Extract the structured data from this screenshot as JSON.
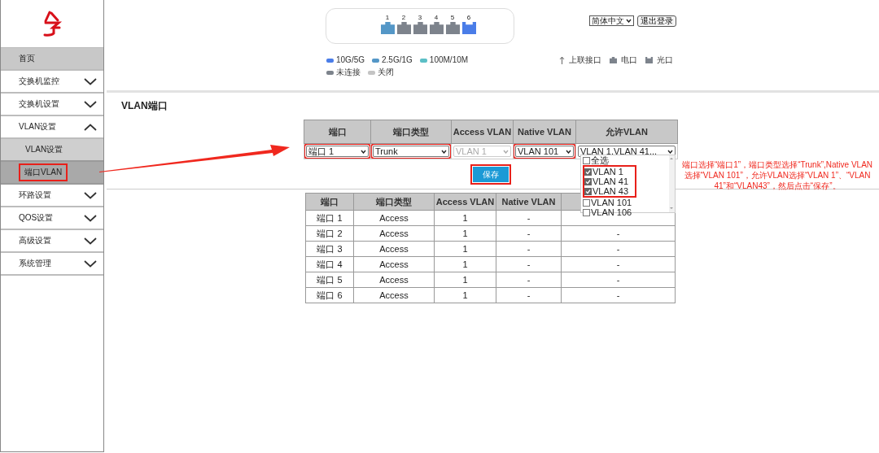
{
  "sidebar": {
    "items": [
      {
        "kind": "home",
        "label": "首页",
        "selected": true
      },
      {
        "kind": "group",
        "label": "交换机监控",
        "expanded": false,
        "selected": false
      },
      {
        "kind": "group",
        "label": "交换机设置",
        "expanded": false,
        "selected": false
      },
      {
        "kind": "group",
        "label": "VLAN设置",
        "expanded": true,
        "selected": false,
        "children": [
          {
            "label": "VLAN设置",
            "selected": false,
            "highlighted": false
          },
          {
            "label": "端口VLAN",
            "selected": true,
            "highlighted": true
          }
        ]
      },
      {
        "kind": "group",
        "label": "环路设置",
        "expanded": false,
        "selected": false
      },
      {
        "kind": "group",
        "label": "QOS设置",
        "expanded": false,
        "selected": false
      },
      {
        "kind": "group",
        "label": "高级设置",
        "expanded": false,
        "selected": false
      },
      {
        "kind": "group",
        "label": "系统管理",
        "expanded": false,
        "selected": false
      }
    ]
  },
  "port_panel": {
    "ports": [
      {
        "label": "1",
        "kind": "electric",
        "color": "#5497c7"
      },
      {
        "label": "2",
        "kind": "electric",
        "color": "#7d838c"
      },
      {
        "label": "3",
        "kind": "electric",
        "color": "#7d838c"
      },
      {
        "label": "4",
        "kind": "electric",
        "color": "#7d838c"
      },
      {
        "label": "5",
        "kind": "electric",
        "color": "#7d838c"
      },
      {
        "label": "6",
        "kind": "optical",
        "color": "#4a7de8"
      }
    ]
  },
  "header": {
    "language": "简体中文",
    "logout": "退出登录"
  },
  "speed_legend": [
    [
      {
        "label": "10G/5G",
        "color": "#4a7de8"
      },
      {
        "label": "2.5G/1G",
        "color": "#5497c7"
      },
      {
        "label": "100M/10M",
        "color": "#5cbfc6"
      }
    ],
    [
      {
        "label": "未连接",
        "color": "#7d838c"
      },
      {
        "label": "关闭",
        "color": "#c4c4c4"
      }
    ]
  ],
  "type_legend": [
    {
      "kind": "uplink",
      "label": "上联接口"
    },
    {
      "kind": "electric",
      "label": "电口"
    },
    {
      "kind": "optical",
      "label": "光口"
    }
  ],
  "page_title": "VLAN端口",
  "config_table": {
    "columns": [
      "端口",
      "端口类型",
      "Access VLAN",
      "Native VLAN",
      "允许VLAN"
    ],
    "fields": [
      {
        "value": "端口 1",
        "disabled": false,
        "highlighted": true
      },
      {
        "value": "Trunk",
        "disabled": false,
        "highlighted": true
      },
      {
        "value": "VLAN 1",
        "disabled": true,
        "highlighted": false
      },
      {
        "value": "VLAN 101",
        "disabled": false,
        "highlighted": true
      },
      {
        "value": "VLAN 1,VLAN 41...",
        "disabled": false,
        "highlighted": false
      }
    ]
  },
  "save_button": {
    "label": "保存",
    "highlighted": true
  },
  "vlan_dropdown": {
    "options": [
      {
        "label": "全选",
        "checked": false,
        "highlighted": false
      },
      {
        "label": "VLAN 1",
        "checked": true,
        "highlighted": true
      },
      {
        "label": "VLAN 41",
        "checked": true,
        "highlighted": true
      },
      {
        "label": "VLAN 43",
        "checked": true,
        "highlighted": true
      },
      {
        "label": "VLAN 101",
        "checked": false,
        "highlighted": false
      },
      {
        "label": "VLAN 106",
        "checked": false,
        "highlighted": false
      }
    ]
  },
  "port_table": {
    "columns": [
      "端口",
      "端口类型",
      "Access VLAN",
      "Native VLAN"
    ],
    "rows": [
      [
        "端口 1",
        "Access",
        "1",
        "-"
      ],
      [
        "端口 2",
        "Access",
        "1",
        "-",
        "-"
      ],
      [
        "端口 3",
        "Access",
        "1",
        "-",
        "-"
      ],
      [
        "端口 4",
        "Access",
        "1",
        "-",
        "-"
      ],
      [
        "端口 5",
        "Access",
        "1",
        "-",
        "-"
      ],
      [
        "端口 6",
        "Access",
        "1",
        "-",
        "-"
      ]
    ]
  },
  "annotation": "端口选择“端口1”，端口类型选择“Trunk”,Native VLAN选择“VLAN 101”，允许VLAN选择“VLAN 1”、“VLAN 41”和“VLAN43”，然后点击“保存”。"
}
